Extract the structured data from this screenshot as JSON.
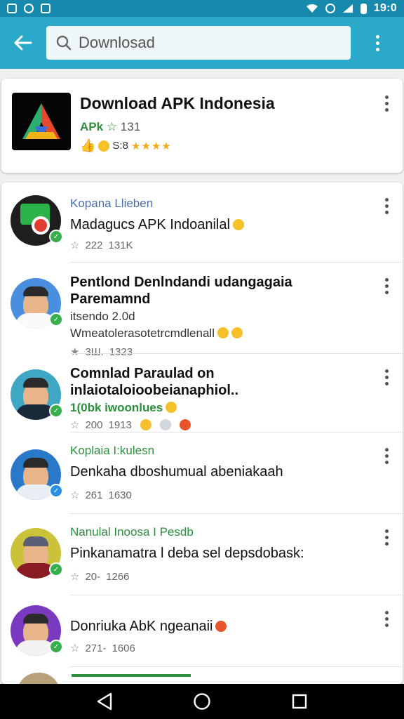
{
  "status_bar": {
    "time": "19:0"
  },
  "search": {
    "placeholder": "Downlosad"
  },
  "featured": {
    "title": "Download APK Indonesia",
    "sub_label": "APk",
    "sub_stars": "☆",
    "sub_count": "131",
    "rating_text": "S:8",
    "stars": "★★★★"
  },
  "items": [
    {
      "tag": "Kopana Llieben",
      "title": "Madagucs APK Indoanilal",
      "line": "",
      "rating": "222",
      "count": "131K"
    },
    {
      "tag": "",
      "title": "Pentlond Denlndandi udangagaia Paremamnd",
      "line": "itsendo 2.0d",
      "line2": "Wmeatolerasotetrcmdlenall",
      "rating": "3Ш.",
      "count": "1323"
    },
    {
      "tag": "",
      "title": "Comnlad Paraulad on inlaiotaloioobeianaphiol..",
      "line": "1(0bk iwoonlues",
      "rating": "200",
      "count": "1913"
    },
    {
      "tag": "Koplaia I:kulesn",
      "title": "Denkaha dboshumual abeniakaah",
      "line": "",
      "rating": "261",
      "count": "1630"
    },
    {
      "tag": "Nanulal Inoosa I Pesdb",
      "title": "Pinkanamatra l deba sel depsdobask:",
      "line": "",
      "rating": "20-",
      "count": "1266"
    },
    {
      "tag": "",
      "title": "Donriuka AbK ngeanaii",
      "line": "",
      "rating": "271-",
      "count": "1606"
    }
  ],
  "icons": {
    "back": "back-arrow-icon",
    "search": "search-icon",
    "more": "more-vert-icon",
    "nav_back": "nav-back-icon",
    "nav_home": "nav-home-icon",
    "nav_recent": "nav-recents-icon"
  },
  "colors": {
    "app_bar": "#2ba9c9",
    "status_bar": "#1789ad",
    "accent_green": "#2c8f3e"
  }
}
